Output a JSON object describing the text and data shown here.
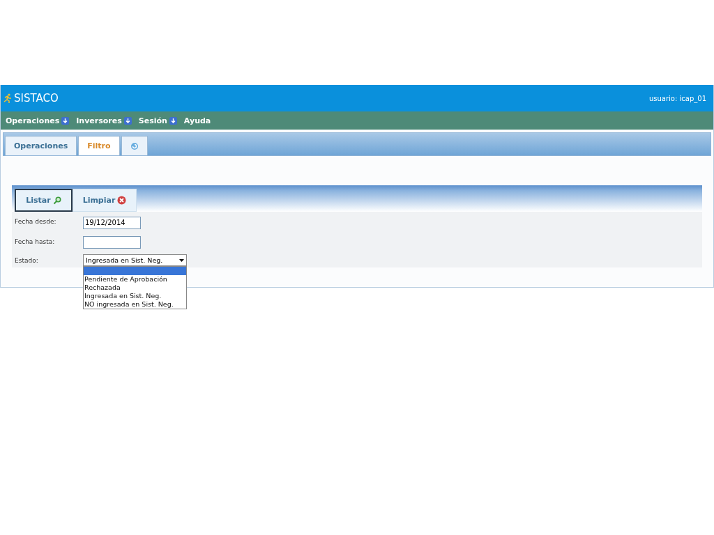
{
  "header": {
    "app_name": "SISTACO",
    "user": "usuario: icap_01"
  },
  "menu": [
    {
      "label": "Operaciones",
      "has_dropdown": true
    },
    {
      "label": "Inversores",
      "has_dropdown": true
    },
    {
      "label": "Sesión",
      "has_dropdown": true
    },
    {
      "label": "Ayuda",
      "has_dropdown": false
    }
  ],
  "tabs": [
    {
      "kind": "text",
      "label": "Operaciones",
      "selected": false
    },
    {
      "kind": "text",
      "label": "Filtro",
      "selected": true
    },
    {
      "kind": "refresh",
      "selected": false
    }
  ],
  "actions": [
    {
      "kind": "search",
      "label": "Listar",
      "selected": true
    },
    {
      "kind": "clear",
      "label": "Limpiar",
      "selected": false
    }
  ],
  "form": {
    "fecha_desde": {
      "label": "Fecha desde:",
      "value": "19/12/2014"
    },
    "fecha_hasta": {
      "label": "Fecha hasta:"
    },
    "estado": {
      "label": "Estado:",
      "value": "Ingresada en Sist. Neg.",
      "expanded": true,
      "blank_option_highlighted": true,
      "options": [
        {
          "label": "Pendiente de Aprobación",
          "highlighted": false
        },
        {
          "label": "Rechazada",
          "highlighted": false
        },
        {
          "label": "Ingresada en Sist. Neg.",
          "highlighted": false
        },
        {
          "label": "NO ingresada en Sist. Neg.",
          "highlighted": false
        }
      ]
    }
  }
}
